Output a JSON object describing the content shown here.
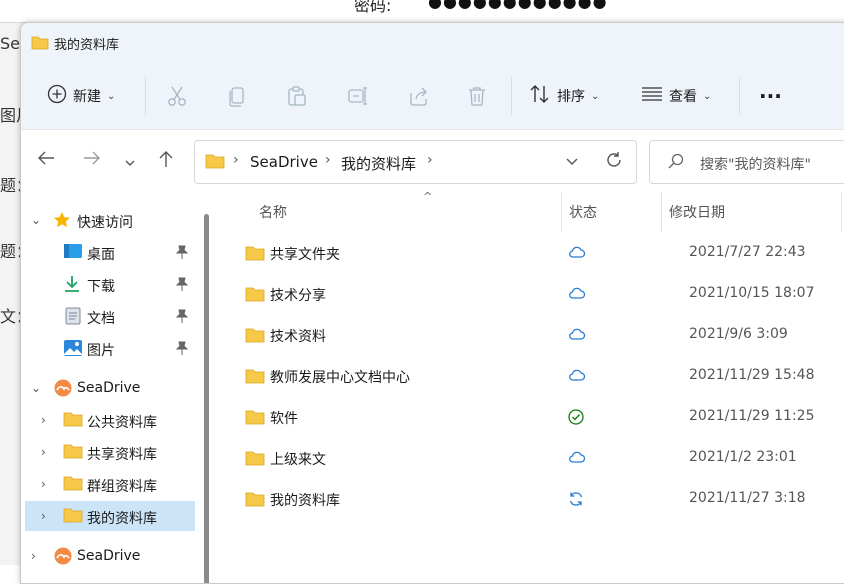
{
  "background": {
    "password_label": "密码:",
    "password_dots": "●●●●●●●●●●●●",
    "left_fragments": [
      "Sea",
      "图片",
      "题：",
      "题：",
      "文："
    ]
  },
  "window": {
    "title": "我的资料库"
  },
  "toolbar": {
    "new_label": "新建",
    "sort_label": "排序",
    "view_label": "查看",
    "more_label": "···"
  },
  "address": {
    "crumbs": [
      "SeaDrive",
      "我的资料库"
    ]
  },
  "search": {
    "placeholder": "搜索\"我的资料库\""
  },
  "nav": {
    "quick_access": "快速访问",
    "items_quick": [
      "桌面",
      "下载",
      "文档",
      "图片"
    ],
    "seadrive": "SeaDrive",
    "items_seadrive": [
      "公共资料库",
      "共享资料库",
      "群组资料库",
      "我的资料库"
    ],
    "seadrive2": "SeaDrive"
  },
  "columns": {
    "name": "名称",
    "status": "状态",
    "modified": "修改日期"
  },
  "files": [
    {
      "name": "共享文件夹",
      "status": "cloud",
      "date": "2021/7/27 22:43"
    },
    {
      "name": "技术分享",
      "status": "cloud",
      "date": "2021/10/15 18:07"
    },
    {
      "name": "技术资料",
      "status": "cloud",
      "date": "2021/9/6 3:09"
    },
    {
      "name": "教师发展中心文档中心",
      "status": "cloud",
      "date": "2021/11/29 15:48"
    },
    {
      "name": "软件",
      "status": "synced",
      "date": "2021/11/29 11:25"
    },
    {
      "name": "上级来文",
      "status": "cloud",
      "date": "2021/1/2 23:01"
    },
    {
      "name": "我的资料库",
      "status": "syncing",
      "date": "2021/11/27 3:18"
    }
  ],
  "colors": {
    "folder": "#f7c948",
    "accent": "#0078d4",
    "selected": "#cce4f7",
    "synced": "#107c10"
  }
}
